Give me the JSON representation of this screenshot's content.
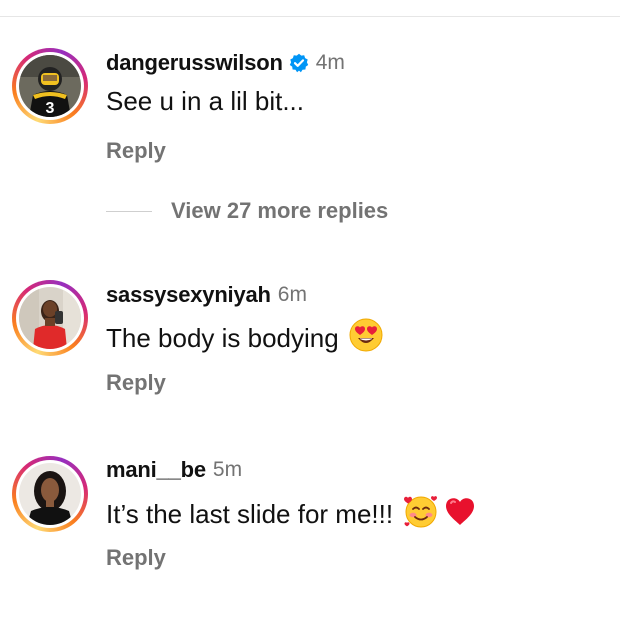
{
  "comments": [
    {
      "username": "dangerusswilson",
      "verified": true,
      "time": "4m",
      "text": "See u in a lil bit...",
      "emojis": [],
      "reply_label": "Reply",
      "avatar_icon": "football-player-avatar"
    },
    {
      "username": "sassysexyniyah",
      "verified": false,
      "time": "6m",
      "text": "The body is bodying",
      "emojis": [
        "heart-eyes-emoji"
      ],
      "reply_label": "Reply",
      "avatar_icon": "woman-mirror-selfie-avatar"
    },
    {
      "username": "mani__be",
      "verified": false,
      "time": "5m",
      "text": "It’s the last slide for me!!!",
      "emojis": [
        "smiling-face-with-hearts-emoji",
        "red-heart-emoji"
      ],
      "reply_label": "Reply",
      "avatar_icon": "woman-portrait-avatar"
    }
  ],
  "view_replies": {
    "label": "View 27 more replies"
  },
  "colors": {
    "story_ring": [
      "#feda75",
      "#fa7e1e",
      "#d62976",
      "#962fbf"
    ],
    "verified_blue": "#0095f6",
    "secondary_text": "#737373"
  }
}
